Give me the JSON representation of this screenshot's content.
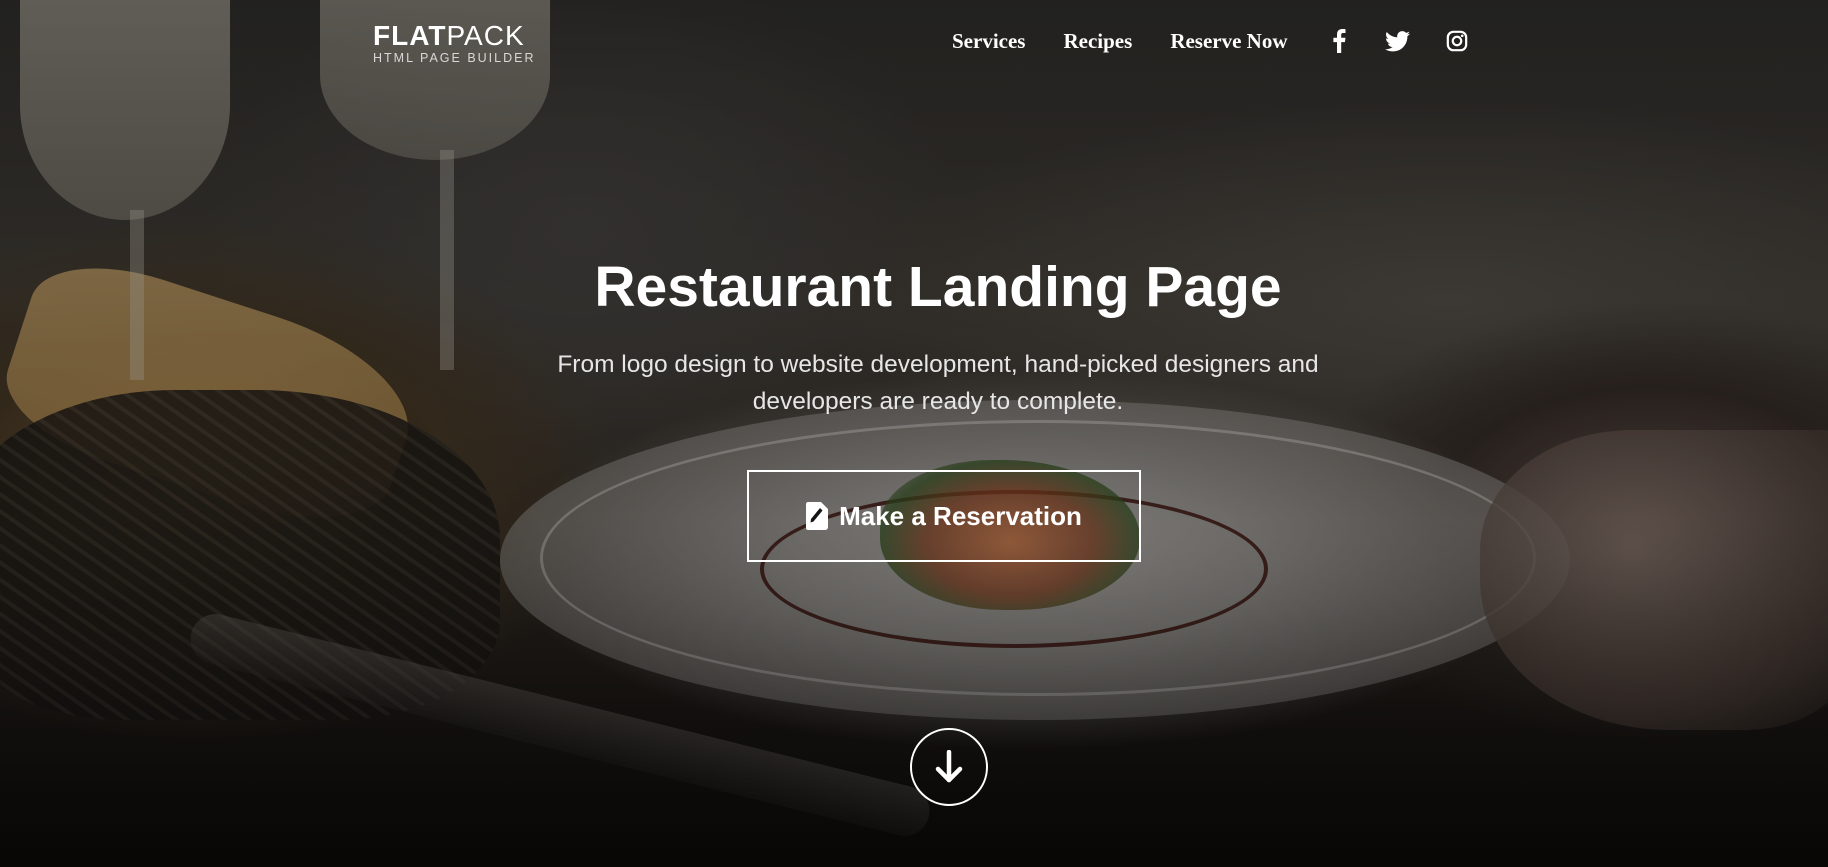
{
  "header": {
    "logo": {
      "bold": "FLAT",
      "light": "PACK",
      "tagline": "HTML PAGE BUILDER"
    },
    "nav": [
      {
        "label": "Services"
      },
      {
        "label": "Recipes"
      },
      {
        "label": "Reserve Now"
      }
    ],
    "social": [
      {
        "icon": "facebook-icon"
      },
      {
        "icon": "twitter-icon"
      },
      {
        "icon": "instagram-icon"
      }
    ]
  },
  "hero": {
    "title": "Restaurant Landing Page",
    "subtitle": "From logo design to website development, hand-picked designers and developers are ready to complete.",
    "cta": {
      "label": "Make a Reservation",
      "icon": "note-icon"
    },
    "scroll_icon": "arrow-down-icon"
  },
  "colors": {
    "text": "#ffffff",
    "subtitle": "#e6e6e6",
    "overlay": "#000000"
  }
}
